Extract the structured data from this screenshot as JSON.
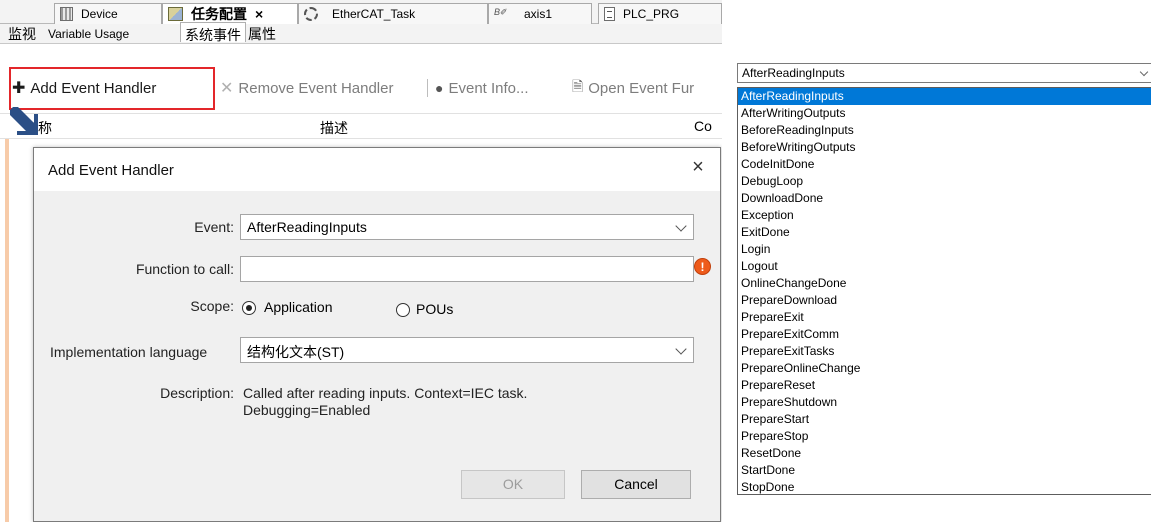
{
  "ide": {
    "doc_tabs": [
      {
        "label": "Device",
        "icon": "device-icon"
      },
      {
        "label": "任务配置",
        "icon": "task-config-icon",
        "close": "×"
      },
      {
        "label": "EtherCAT_Task",
        "icon": "task-gear-icon"
      },
      {
        "label": "axis1",
        "icon": "axis-icon"
      },
      {
        "label": "PLC_PRG",
        "icon": "program-icon"
      }
    ],
    "sub_tabs": [
      "监视",
      "Variable Usage",
      "系统事件",
      "属性"
    ],
    "toolbar": {
      "add": "Add Event Handler",
      "remove": "Remove Event Handler",
      "info": "Event Info...",
      "open": "Open Event Fur"
    },
    "columns": [
      "名称",
      "描述",
      "Co"
    ]
  },
  "dialog": {
    "title": "Add Event Handler",
    "close": "×",
    "event_label": "Event:",
    "event_value": "AfterReadingInputs",
    "function_label": "Function to call:",
    "function_value": "",
    "error_glyph": "!",
    "scope_label": "Scope:",
    "scope_options": [
      "Application",
      "POUs"
    ],
    "scope_selected": "Application",
    "impl_label": "Implementation language",
    "impl_value": "结构化文本(ST)",
    "description_label": "Description:",
    "description_lines": [
      "Called after reading inputs. Context=IEC task.",
      "Debugging=Enabled"
    ],
    "ok": "OK",
    "cancel": "Cancel"
  },
  "event_dropdown": {
    "selected": "AfterReadingInputs",
    "options": [
      "AfterReadingInputs",
      "AfterWritingOutputs",
      "BeforeReadingInputs",
      "BeforeWritingOutputs",
      "CodeInitDone",
      "DebugLoop",
      "DownloadDone",
      "Exception",
      "ExitDone",
      "Login",
      "Logout",
      "OnlineChangeDone",
      "PrepareDownload",
      "PrepareExit",
      "PrepareExitComm",
      "PrepareExitTasks",
      "PrepareOnlineChange",
      "PrepareReset",
      "PrepareShutdown",
      "PrepareStart",
      "PrepareStop",
      "ResetDone",
      "StartDone",
      "StopDone"
    ]
  },
  "colors": {
    "highlight_box": "#e3262a",
    "selection": "#0078d7",
    "error": "#ee5b1b",
    "arrow": "#2b4f86"
  }
}
